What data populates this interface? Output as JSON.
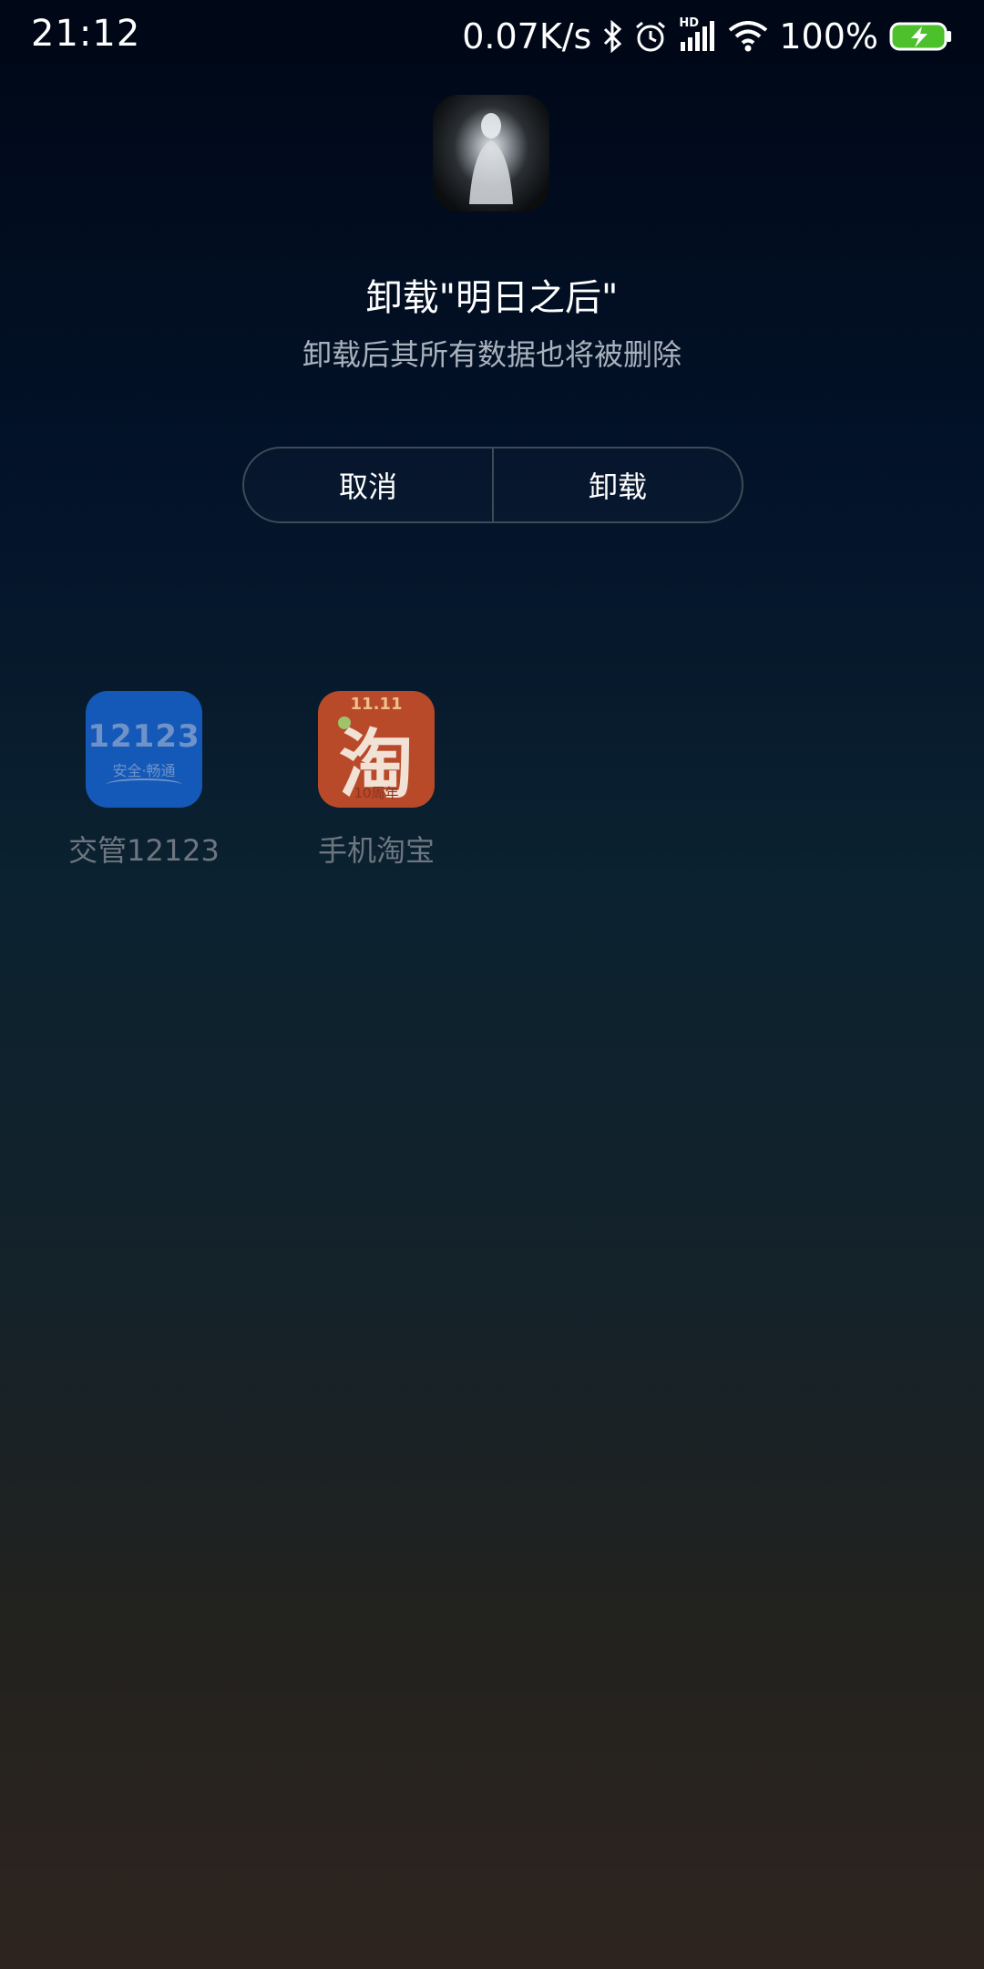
{
  "status_bar": {
    "time": "21:12",
    "net_speed": "0.07K/s",
    "battery": "100%",
    "icons": [
      "bluetooth-icon",
      "alarm-icon",
      "signal-icon",
      "wifi-icon",
      "battery-charging-icon"
    ],
    "hd_label": "HD",
    "battery_color": "#4cc12b"
  },
  "dialog": {
    "app_icon": "app-icon",
    "title": "卸载\"明日之后\"",
    "subtitle": "卸载后其所有数据也将被删除",
    "cancel_label": "取消",
    "uninstall_label": "卸载"
  },
  "home_apps": [
    {
      "label": "交管12123",
      "icon": "app-12123-icon",
      "icon_text": "12123",
      "icon_subtext": "安全·畅通"
    },
    {
      "label": "手机淘宝",
      "icon": "taobao-icon",
      "icon_top": "11.11",
      "icon_text": "淘",
      "icon_bottom": "10周年"
    }
  ]
}
